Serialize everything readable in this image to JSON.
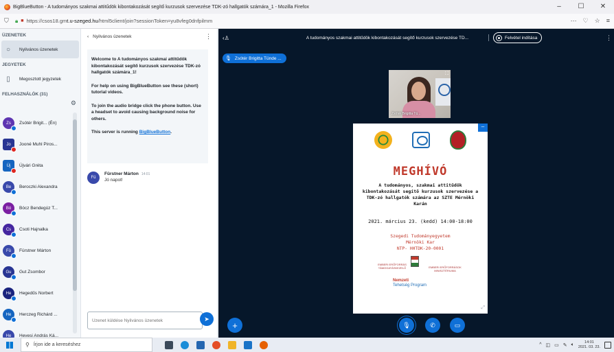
{
  "browser": {
    "title": "BigBlueButton - A tudományos szakmai attitűdök kibontakozását segítő kurzusok szervezése TDK-zó hallgatók számára_1 - Mozilla Firefox",
    "url_prefix": "https://csos18.gm",
    "url_domain": "t.u-szeged.hu",
    "url_suffix": "/html5client/join?sessionToken=yu8vfeg0dnfpilmm",
    "window_min": "–",
    "window_max": "☐",
    "window_close": "✕"
  },
  "sidebar": {
    "messages_header": "ÜZENETEK",
    "public_chat": "Nyilvános üzenetek",
    "notes_header": "JEGYETEK",
    "shared_notes": "Megosztott jegyzetek",
    "users_header": "FELHASZNÁLÓK (31)",
    "users": [
      {
        "initials": "Zs",
        "name": "Zsótér Brigit... (Én)",
        "color": "#5e35b1",
        "square": false,
        "badge": "blue"
      },
      {
        "initials": "Jo",
        "name": "Jooné Muhl Piros...",
        "color": "#283593",
        "square": true,
        "badge": "red"
      },
      {
        "initials": "Új",
        "name": "Újvári Gréta",
        "color": "#1565c0",
        "square": true,
        "badge": "red"
      },
      {
        "initials": "Be",
        "name": "Beroczki Alexandra",
        "color": "#3949ab",
        "square": false,
        "badge": "blue"
      },
      {
        "initials": "Bó",
        "name": "Bócz Bendegúz T...",
        "color": "#7b1fa2",
        "square": false,
        "badge": "blue"
      },
      {
        "initials": "Cs",
        "name": "Csoti Hajnalka",
        "color": "#4527a0",
        "square": false,
        "badge": "blue"
      },
      {
        "initials": "Fü",
        "name": "Fürstner Márton",
        "color": "#3949ab",
        "square": false,
        "badge": "blue"
      },
      {
        "initials": "Gu",
        "name": "Gut Zsombor",
        "color": "#283593",
        "square": false,
        "badge": "blue"
      },
      {
        "initials": "He",
        "name": "Hegedűs Norbert",
        "color": "#1a237e",
        "square": false,
        "badge": "blue"
      },
      {
        "initials": "He",
        "name": "Herczeg Richárd ...",
        "color": "#1565c0",
        "square": false,
        "badge": "blue"
      },
      {
        "initials": "He",
        "name": "Hevesi András Ká...",
        "color": "#3949ab",
        "square": false,
        "badge": "blue"
      }
    ]
  },
  "chat": {
    "back_label": "Nyilvános üzenetek",
    "welcome_title": "Welcome to A tudományos szakmai attitűdök kibontakozását segítő kurzusok szervezése TDK-zó hallgatók számára_1!",
    "welcome_help": "For help on using BigBlueButton see these (short) tutorial videos.",
    "welcome_audio": "To join the audio bridge click the phone button. Use a headset to avoid causing background noise for others.",
    "welcome_running_prefix": "This server is running ",
    "welcome_running_link": "BigBlueButton",
    "welcome_running_suffix": ".",
    "message": {
      "initials": "Fü",
      "author": "Fürstner Márton",
      "time": "14:01",
      "text": "Jó napot!"
    },
    "input_placeholder": "Üzenet küldése Nyilvános üzenetek"
  },
  "main": {
    "title": "A tudományos szakmai attitűdök kibontakozását segítő kurzusok szervezése TD...",
    "record_label": "Felvétel indítása",
    "talking": "Zsótér Brigitta Tünde ...",
    "webcam_caption": "Zsótér Brigitta Tü...",
    "slide": {
      "headline": "MEGHÍVÓ",
      "description": "A tudományos, szakmai attitűdök kibontakozását segítő kurzusok szervezése a TDK-zó hallgatók számára az SZTE Mérnöki Karán",
      "date": "2021. március 23. (kedd) 14:00-18:00",
      "org_1": "Szegedi Tudományegyetem",
      "org_2": "Mérnöki Kar",
      "org_3": "NTP- HHTDK-20-0001",
      "funder_1": "EMBERI ERŐFORRÁS TÁMOGATÁSKEZELŐ",
      "funder_2": "EMBERI ERŐFORRÁSOK MINISZTÉRIUMA",
      "program_1": "Nemzeti",
      "program_2": "Tehetség Program"
    }
  },
  "taskbar": {
    "search_placeholder": "Írjon ide a kereséshez",
    "time": "14:01",
    "date": "2021. 03. 23."
  },
  "colors": {
    "accent": "#0f70d7",
    "main_bg": "#06172a",
    "headline": "#c0392b"
  }
}
